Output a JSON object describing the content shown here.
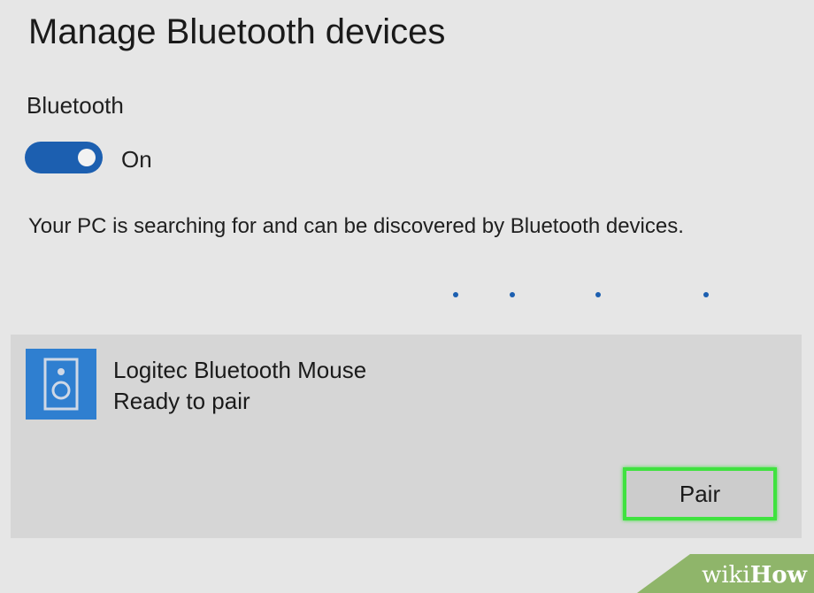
{
  "page": {
    "title": "Manage Bluetooth devices"
  },
  "bluetooth": {
    "label": "Bluetooth",
    "toggle_state": "On",
    "toggle_on": true,
    "status": "Your PC is searching for and can be discovered by Bluetooth devices."
  },
  "progress": {
    "icon": "searching-progress-dots",
    "dot_count": 4
  },
  "device": {
    "icon": "speaker-icon",
    "name": "Logitec Bluetooth Mouse",
    "status": "Ready to pair",
    "pair_label": "Pair"
  },
  "watermark": {
    "prefix": "wiki",
    "suffix": "How"
  },
  "colors": {
    "background": "#e6e6e6",
    "accent": "#1c5fb0",
    "device_icon": "#2f7fd0",
    "card": "#d6d6d6",
    "highlight": "#3fe23f",
    "watermark": "#8fb56a"
  }
}
